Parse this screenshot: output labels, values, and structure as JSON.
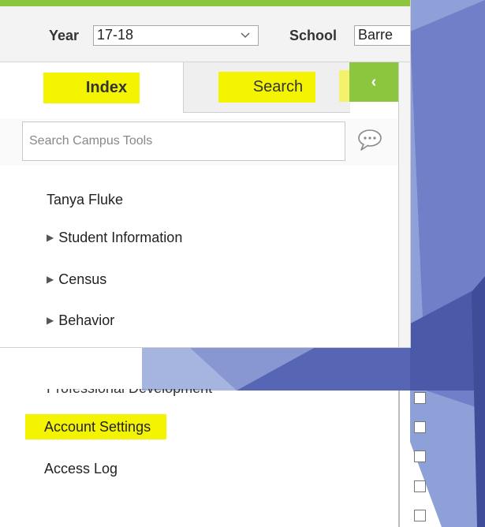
{
  "topbar": {
    "year_label": "Year",
    "year_value": "17-18",
    "school_label": "School",
    "school_value": "Barre"
  },
  "tabs": {
    "index_label": "Index",
    "search_label": "Search",
    "collapse_glyph": "‹"
  },
  "search": {
    "placeholder": "Search Campus Tools"
  },
  "nav": {
    "user_name": "Tanya Fluke",
    "items": [
      {
        "label": "Student Information"
      },
      {
        "label": "Census"
      },
      {
        "label": "Behavior"
      }
    ]
  },
  "lower_nav": {
    "partial_item": "Professional Development",
    "account_settings": "Account Settings",
    "access_log": "Access Log"
  },
  "icons": {
    "chat": "chat-bubble-icon",
    "expand": "triangle-right-icon",
    "dropdown": "chevron-down-icon"
  },
  "colors": {
    "accent_green": "#8cc63f",
    "highlight_yellow": "#f4f400",
    "slide_blue": "#5a6bb8"
  }
}
